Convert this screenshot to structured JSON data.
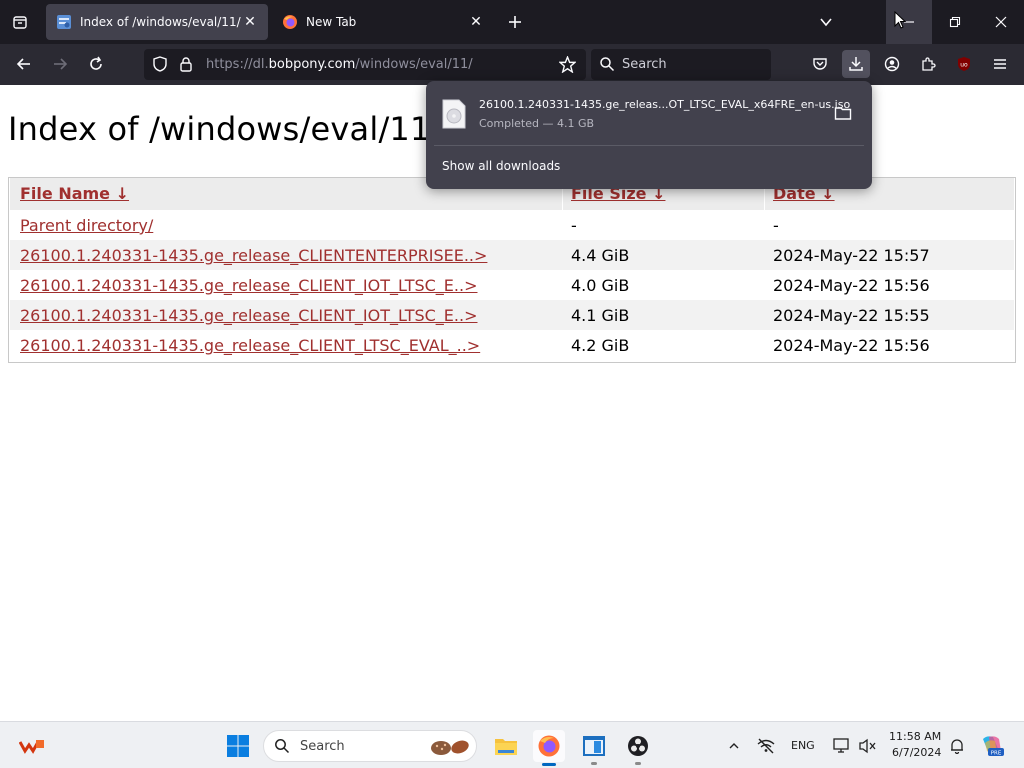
{
  "browser": {
    "tabs": [
      {
        "title": "Index of /windows/eval/11/",
        "active": true
      },
      {
        "title": "New Tab",
        "active": false
      }
    ],
    "url": {
      "prefix": "https://dl.",
      "host": "bobpony.com",
      "path": "/windows/eval/11/"
    },
    "search_placeholder": "Search"
  },
  "page": {
    "title": "Index of /windows/eval/11/",
    "columns": [
      "File Name  ↓",
      "File Size  ↓",
      "Date  ↓"
    ],
    "rows": [
      {
        "name": "Parent directory/",
        "size": "-",
        "date": "-"
      },
      {
        "name": "26100.1.240331-1435.ge_release_CLIENTENTERPRISEE..>",
        "size": "4.4 GiB",
        "date": "2024-May-22 15:57"
      },
      {
        "name": "26100.1.240331-1435.ge_release_CLIENT_IOT_LTSC_E..>",
        "size": "4.0 GiB",
        "date": "2024-May-22 15:56"
      },
      {
        "name": "26100.1.240331-1435.ge_release_CLIENT_IOT_LTSC_E..>",
        "size": "4.1 GiB",
        "date": "2024-May-22 15:55"
      },
      {
        "name": "26100.1.240331-1435.ge_release_CLIENT_LTSC_EVAL_..>",
        "size": "4.2 GiB",
        "date": "2024-May-22 15:56"
      }
    ]
  },
  "downloads": {
    "item_name": "26100.1.240331-1435.ge_releas...OT_LTSC_EVAL_x64FRE_en-us.iso",
    "item_status": "Completed — 4.1 GB",
    "show_all": "Show all downloads"
  },
  "taskbar": {
    "search_placeholder": "Search",
    "language": "ENG",
    "time": "11:58 AM",
    "date": "6/7/2024"
  },
  "colors": {
    "link": "#a0302f",
    "chrome_dark": "#1c1b22",
    "toolbar": "#2b2a33",
    "accent": "#0067c0"
  }
}
